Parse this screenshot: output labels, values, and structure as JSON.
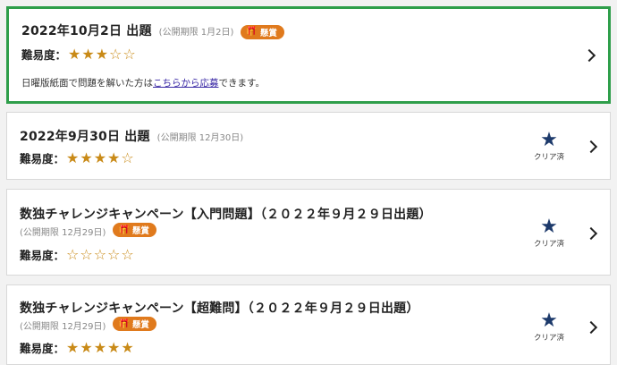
{
  "items": [
    {
      "title": "2022年10月2日 出題",
      "deadline": "(公開期限 1月2日)",
      "badge": "懸賞",
      "difficulty_label": "難易度：",
      "stars": "★★★☆☆",
      "difficulty_level": 3,
      "note_before": "日曜版紙面で問題を解いた方は",
      "note_link": "こちらから応募",
      "note_after": "できます。"
    },
    {
      "title": "2022年9月30日 出題",
      "deadline": "(公開期限 12月30日)",
      "difficulty_label": "難易度：",
      "stars": "★★★★☆",
      "difficulty_level": 4,
      "clear_label": "クリア済"
    },
    {
      "title": "数独チャレンジキャンペーン【入門問題】（２０２２年９月２９日出題）",
      "deadline": "(公開期限 12月29日)",
      "badge": "懸賞",
      "difficulty_label": "難易度：",
      "stars": "☆☆☆☆☆",
      "difficulty_level": 0,
      "clear_label": "クリア済"
    },
    {
      "title": "数独チャレンジキャンペーン【超難問】（２０２２年９月２９日出題）",
      "deadline": "(公開期限 12月29日)",
      "badge": "懸賞",
      "difficulty_label": "難易度：",
      "stars": "★★★★★",
      "difficulty_level": 5,
      "clear_label": "クリア済"
    }
  ],
  "icons": {
    "gift": "gift-icon",
    "chevron": "chevron-right-icon",
    "clear_star": "star-icon"
  },
  "colors": {
    "highlight_border": "#2e9e4a",
    "badge": "#e07a1d",
    "stars": "#c98a17",
    "clear_star": "#1d3a6b",
    "link": "#3b2aa6"
  }
}
